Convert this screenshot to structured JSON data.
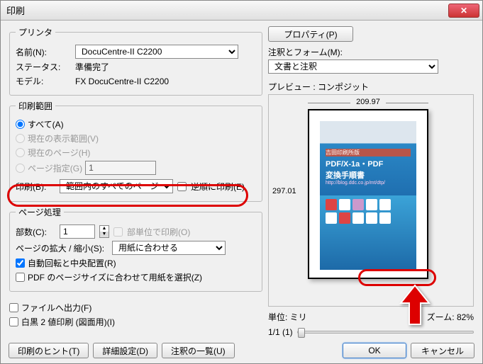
{
  "title": "印刷",
  "printer": {
    "legend": "プリンタ",
    "name_label": "名前(N):",
    "name_value": "DocuCentre-II C2200",
    "properties_btn": "プロパティ(P)",
    "status_label": "ステータス:",
    "status_value": "準備完了",
    "model_label": "モデル:",
    "model_value": "FX DocuCentre-II C2200"
  },
  "annot": {
    "label": "注釈とフォーム(M):",
    "value": "文書と注釈"
  },
  "range": {
    "legend": "印刷範囲",
    "all": "すべて(A)",
    "current_view": "現在の表示範囲(V)",
    "current_page": "現在のページ(H)",
    "pages": "ページ指定(G)",
    "pages_value": "1",
    "print_label": "印刷(B):",
    "print_value": "範囲内のすべてのページ",
    "reverse": "逆順に印刷(E)"
  },
  "handling": {
    "legend": "ページ処理",
    "copies_label": "部数(C):",
    "copies_value": "1",
    "collate": "部単位で印刷(O)",
    "scale_label": "ページの拡大 / 縮小(S):",
    "scale_value": "用紙に合わせる",
    "autorotate": "自動回転と中央配置(R)",
    "pdf_size": "PDF のページサイズに合わせて用紙を選択(Z)"
  },
  "output": {
    "to_file": "ファイルへ出力(F)",
    "bw2": "白黒 2 値印刷 (図面用)(I)"
  },
  "preview": {
    "label": "プレビュー : コンポジット",
    "width": "209.97",
    "height": "297.01",
    "unit_label": "単位: ミリ",
    "zoom_label": "ズーム: 82%",
    "pages": "1/1 (1)",
    "doc_band": "吉田印刷所版",
    "doc_line1": "PDF/X-1a・PDF",
    "doc_line2": "変換手順書",
    "doc_url": "http://blog.ddc.co.jp/mt/dtp/"
  },
  "buttons": {
    "hint": "印刷のヒント(T)",
    "advanced": "詳細設定(D)",
    "comments": "注釈の一覧(U)",
    "ok": "OK",
    "cancel": "キャンセル"
  }
}
